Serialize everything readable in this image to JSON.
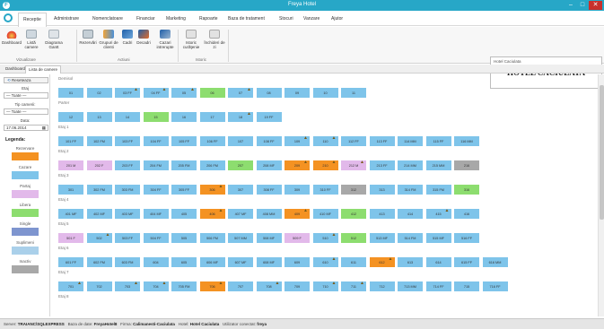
{
  "window": {
    "title": "Freya Hotel",
    "app_icon": "freya-logo-icon"
  },
  "menu": [
    "Receptie",
    "Administrare",
    "Nomenclatoare",
    "Financiar",
    "Marketing",
    "Rapoarte",
    "Baza de tratament",
    "Stocuri",
    "Vanzare",
    "Ajutor"
  ],
  "ribbon": {
    "buttons": [
      "Dashboard",
      "Listă camere",
      "Diagrama Gantt",
      "Rezervări",
      "Grupuri de clienti",
      "Cadri",
      "Decadri",
      "Cazari intrerupte",
      "Istoric curăţenie",
      "Închideri de zi"
    ],
    "groups": [
      "Vizualizare",
      "Actiuni",
      "Istoric"
    ]
  },
  "hotel": {
    "label": "Hotel Caciulata",
    "name": "HOTEL CACIULATA"
  },
  "doc_tabs": [
    "Dashboard",
    "Lista de camere"
  ],
  "filters": {
    "reset": "Reseteaza",
    "floor_label": "Etaj",
    "floor_value": "— Toate —",
    "type_label": "Tip camerii:",
    "type_value": "— Toate —",
    "date_label": "Data:",
    "date_value": "17.06.2014"
  },
  "legend": {
    "title": "Legenda:",
    "items": [
      {
        "label": "Rezervare",
        "color": "#f49222"
      },
      {
        "label": "Cazare",
        "color": "#7ec4ea"
      },
      {
        "label": "Partaj",
        "color": "#e2b9ea"
      },
      {
        "label": "Libera",
        "color": "#8ddd6f"
      },
      {
        "label": "Single",
        "color": "#7e95cf"
      },
      {
        "label": "Suplimeni",
        "color": "#aad0ea"
      },
      {
        "label": "Inactiv",
        "color": "#a8a8a8"
      }
    ]
  },
  "floors": [
    {
      "label": "Demisol",
      "rooms": [
        {
          "n": "01",
          "s": "occupied"
        },
        {
          "n": "02",
          "s": "occupied"
        },
        {
          "n": "03 FF",
          "s": "occupied",
          "f": 1
        },
        {
          "n": "04 FF",
          "s": "occupied",
          "f": 1
        },
        {
          "n": "05",
          "s": "occupied",
          "f": 1
        },
        {
          "n": "06",
          "s": "free"
        },
        {
          "n": "07",
          "s": "occupied",
          "f": 1
        },
        {
          "n": "08",
          "s": "occupied"
        },
        {
          "n": "09",
          "s": "occupied"
        },
        {
          "n": "10",
          "s": "occupied"
        },
        {
          "n": "11",
          "s": "occupied"
        }
      ]
    },
    {
      "label": "Parter",
      "rooms": [
        {
          "n": "12",
          "s": "occupied"
        },
        {
          "n": "13",
          "s": "occupied"
        },
        {
          "n": "14",
          "s": "occupied"
        },
        {
          "n": "15",
          "s": "free"
        },
        {
          "n": "16",
          "s": "occupied"
        },
        {
          "n": "17",
          "s": "occupied"
        },
        {
          "n": "18",
          "s": "occupied",
          "f": 1
        },
        {
          "n": "19 FF",
          "s": "occupied"
        }
      ]
    },
    {
      "label": "Etaj 1",
      "rooms": [
        {
          "n": "101 FF",
          "s": "occupied"
        },
        {
          "n": "102 FM",
          "s": "occupied"
        },
        {
          "n": "103 FF",
          "s": "occupied"
        },
        {
          "n": "104 FF",
          "s": "occupied"
        },
        {
          "n": "105 FF",
          "s": "occupied"
        },
        {
          "n": "106 FF",
          "s": "occupied"
        },
        {
          "n": "107",
          "s": "occupied"
        },
        {
          "n": "108 FF",
          "s": "occupied"
        },
        {
          "n": "109",
          "s": "occupied",
          "f": 1
        },
        {
          "n": "110",
          "s": "occupied",
          "f": 1
        },
        {
          "n": "112 FF",
          "s": "occupied"
        },
        {
          "n": "113 FF",
          "s": "occupied"
        },
        {
          "n": "114 MM",
          "s": "occupied"
        },
        {
          "n": "115 FF",
          "s": "occupied"
        },
        {
          "n": "116 MM",
          "s": "occupied"
        }
      ]
    },
    {
      "label": "Etaj 2",
      "rooms": [
        {
          "n": "201 M",
          "s": "partial"
        },
        {
          "n": "202 F",
          "s": "partial"
        },
        {
          "n": "203 FF",
          "s": "occupied"
        },
        {
          "n": "204 FM",
          "s": "occupied"
        },
        {
          "n": "205 FM",
          "s": "occupied"
        },
        {
          "n": "206 FM",
          "s": "occupied"
        },
        {
          "n": "207",
          "s": "free"
        },
        {
          "n": "208 MF",
          "s": "occupied"
        },
        {
          "n": "209",
          "s": "reserved",
          "f": 1
        },
        {
          "n": "210",
          "s": "reserved",
          "f": 1
        },
        {
          "n": "212 M",
          "s": "partial",
          "f": 1
        },
        {
          "n": "213 FF",
          "s": "occupied"
        },
        {
          "n": "214 MM",
          "s": "occupied"
        },
        {
          "n": "215 MM",
          "s": "occupied"
        },
        {
          "n": "216",
          "s": "inactive"
        }
      ]
    },
    {
      "label": "Etaj 3",
      "rooms": [
        {
          "n": "301",
          "s": "occupied"
        },
        {
          "n": "302 FM",
          "s": "occupied"
        },
        {
          "n": "303 FM",
          "s": "occupied"
        },
        {
          "n": "304 FF",
          "s": "occupied"
        },
        {
          "n": "305 FF",
          "s": "occupied"
        },
        {
          "n": "306",
          "s": "reserved",
          "f": 1
        },
        {
          "n": "307",
          "s": "occupied"
        },
        {
          "n": "308 FF",
          "s": "occupied"
        },
        {
          "n": "309",
          "s": "occupied"
        },
        {
          "n": "310 FF",
          "s": "occupied"
        },
        {
          "n": "312",
          "s": "inactive"
        },
        {
          "n": "313",
          "s": "occupied"
        },
        {
          "n": "314 FM",
          "s": "occupied"
        },
        {
          "n": "315 FM",
          "s": "occupied"
        },
        {
          "n": "316",
          "s": "free"
        }
      ]
    },
    {
      "label": "Etaj 4",
      "rooms": [
        {
          "n": "401 MF",
          "s": "occupied"
        },
        {
          "n": "402 MF",
          "s": "occupied"
        },
        {
          "n": "403 MF",
          "s": "occupied"
        },
        {
          "n": "404 MF",
          "s": "occupied"
        },
        {
          "n": "405",
          "s": "occupied"
        },
        {
          "n": "406",
          "s": "reserved",
          "f": 1
        },
        {
          "n": "407 MF",
          "s": "occupied"
        },
        {
          "n": "408 MM",
          "s": "occupied"
        },
        {
          "n": "409",
          "s": "reserved",
          "f": 1
        },
        {
          "n": "410 MF",
          "s": "occupied"
        },
        {
          "n": "412",
          "s": "free"
        },
        {
          "n": "413",
          "s": "occupied"
        },
        {
          "n": "414",
          "s": "occupied"
        },
        {
          "n": "415",
          "s": "occupied",
          "f": 1
        },
        {
          "n": "416",
          "s": "occupied"
        }
      ]
    },
    {
      "label": "Etaj 5",
      "rooms": [
        {
          "n": "501 F",
          "s": "partial"
        },
        {
          "n": "502",
          "s": "occupied",
          "f": 1
        },
        {
          "n": "503 FF",
          "s": "occupied"
        },
        {
          "n": "504 FF",
          "s": "occupied"
        },
        {
          "n": "505",
          "s": "occupied"
        },
        {
          "n": "506 FM",
          "s": "occupied"
        },
        {
          "n": "507 MM",
          "s": "occupied"
        },
        {
          "n": "508 MF",
          "s": "occupied"
        },
        {
          "n": "509 F",
          "s": "partial"
        },
        {
          "n": "510",
          "s": "occupied",
          "f": 1
        },
        {
          "n": "512",
          "s": "free"
        },
        {
          "n": "513 MF",
          "s": "occupied"
        },
        {
          "n": "514 FM",
          "s": "occupied"
        },
        {
          "n": "515 MF",
          "s": "occupied"
        },
        {
          "n": "516 FF",
          "s": "occupied"
        }
      ]
    },
    {
      "label": "Etaj 6",
      "rooms": [
        {
          "n": "601 FF",
          "s": "occupied"
        },
        {
          "n": "602 FM",
          "s": "occupied"
        },
        {
          "n": "603 FM",
          "s": "occupied"
        },
        {
          "n": "604",
          "s": "occupied"
        },
        {
          "n": "605",
          "s": "occupied"
        },
        {
          "n": "606 MF",
          "s": "occupied"
        },
        {
          "n": "607 MF",
          "s": "occupied"
        },
        {
          "n": "608 MF",
          "s": "occupied"
        },
        {
          "n": "609",
          "s": "occupied"
        },
        {
          "n": "610",
          "s": "occupied",
          "f": 1
        },
        {
          "n": "611",
          "s": "occupied"
        },
        {
          "n": "612",
          "s": "reserved",
          "f": 1
        },
        {
          "n": "613",
          "s": "occupied"
        },
        {
          "n": "614",
          "s": "occupied"
        },
        {
          "n": "615 FF",
          "s": "occupied"
        },
        {
          "n": "616 MM",
          "s": "occupied"
        }
      ]
    },
    {
      "label": "Etaj 7",
      "rooms": [
        {
          "n": "701",
          "s": "occupied",
          "f": 1
        },
        {
          "n": "702",
          "s": "occupied"
        },
        {
          "n": "703",
          "s": "occupied",
          "f": 1
        },
        {
          "n": "704",
          "s": "occupied",
          "f": 1
        },
        {
          "n": "705 FM",
          "s": "occupied"
        },
        {
          "n": "706",
          "s": "reserved",
          "f": 1
        },
        {
          "n": "707",
          "s": "occupied"
        },
        {
          "n": "708",
          "s": "occupied",
          "f": 1
        },
        {
          "n": "709",
          "s": "occupied"
        },
        {
          "n": "710",
          "s": "occupied",
          "f": 1
        },
        {
          "n": "711",
          "s": "occupied",
          "f": 1
        },
        {
          "n": "712",
          "s": "occupied"
        },
        {
          "n": "713 MM",
          "s": "occupied"
        },
        {
          "n": "714 FF",
          "s": "occupied"
        },
        {
          "n": "715",
          "s": "occupied"
        },
        {
          "n": "716 FF",
          "s": "occupied"
        }
      ]
    },
    {
      "label": "Etaj 8",
      "rooms": []
    }
  ],
  "status": {
    "server_label": "Server:",
    "server": "TRAIANC\\SQLEXPRESS",
    "db_label": "Baza de date:",
    "db": "FreyaHotel8",
    "firm_label": "Firma:",
    "firm": "Calimanesti-Caciulata",
    "hotel_label": "Hotel:",
    "hotel": "Hotel Caciulata",
    "user_label": "Utilizator conectat:",
    "user": "freya"
  }
}
